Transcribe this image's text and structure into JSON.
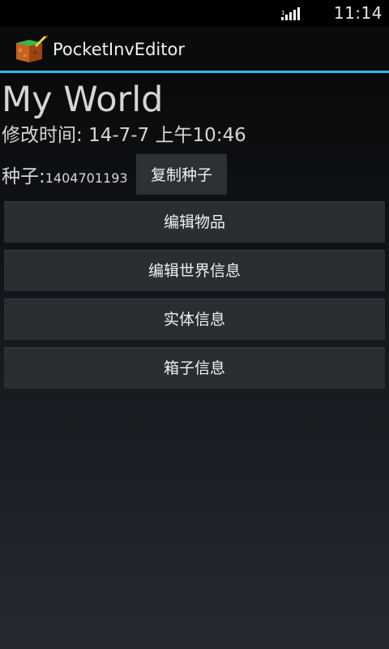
{
  "status_bar": {
    "time": "11:14",
    "signal_icon": "signal-icon"
  },
  "action_bar": {
    "app_icon": "app-cube-icon",
    "title": "PocketInvEditor",
    "accent_color": "#33b5e5"
  },
  "world": {
    "name": "My World",
    "modified_label": "修改时间: ",
    "modified_value": "14-7-7 上午10:46",
    "seed_label": "种子:",
    "seed_value": "1404701193",
    "copy_seed_label": "复制种子"
  },
  "menu": [
    {
      "label": "编辑物品"
    },
    {
      "label": "编辑世界信息"
    },
    {
      "label": "实体信息"
    },
    {
      "label": "箱子信息"
    }
  ]
}
